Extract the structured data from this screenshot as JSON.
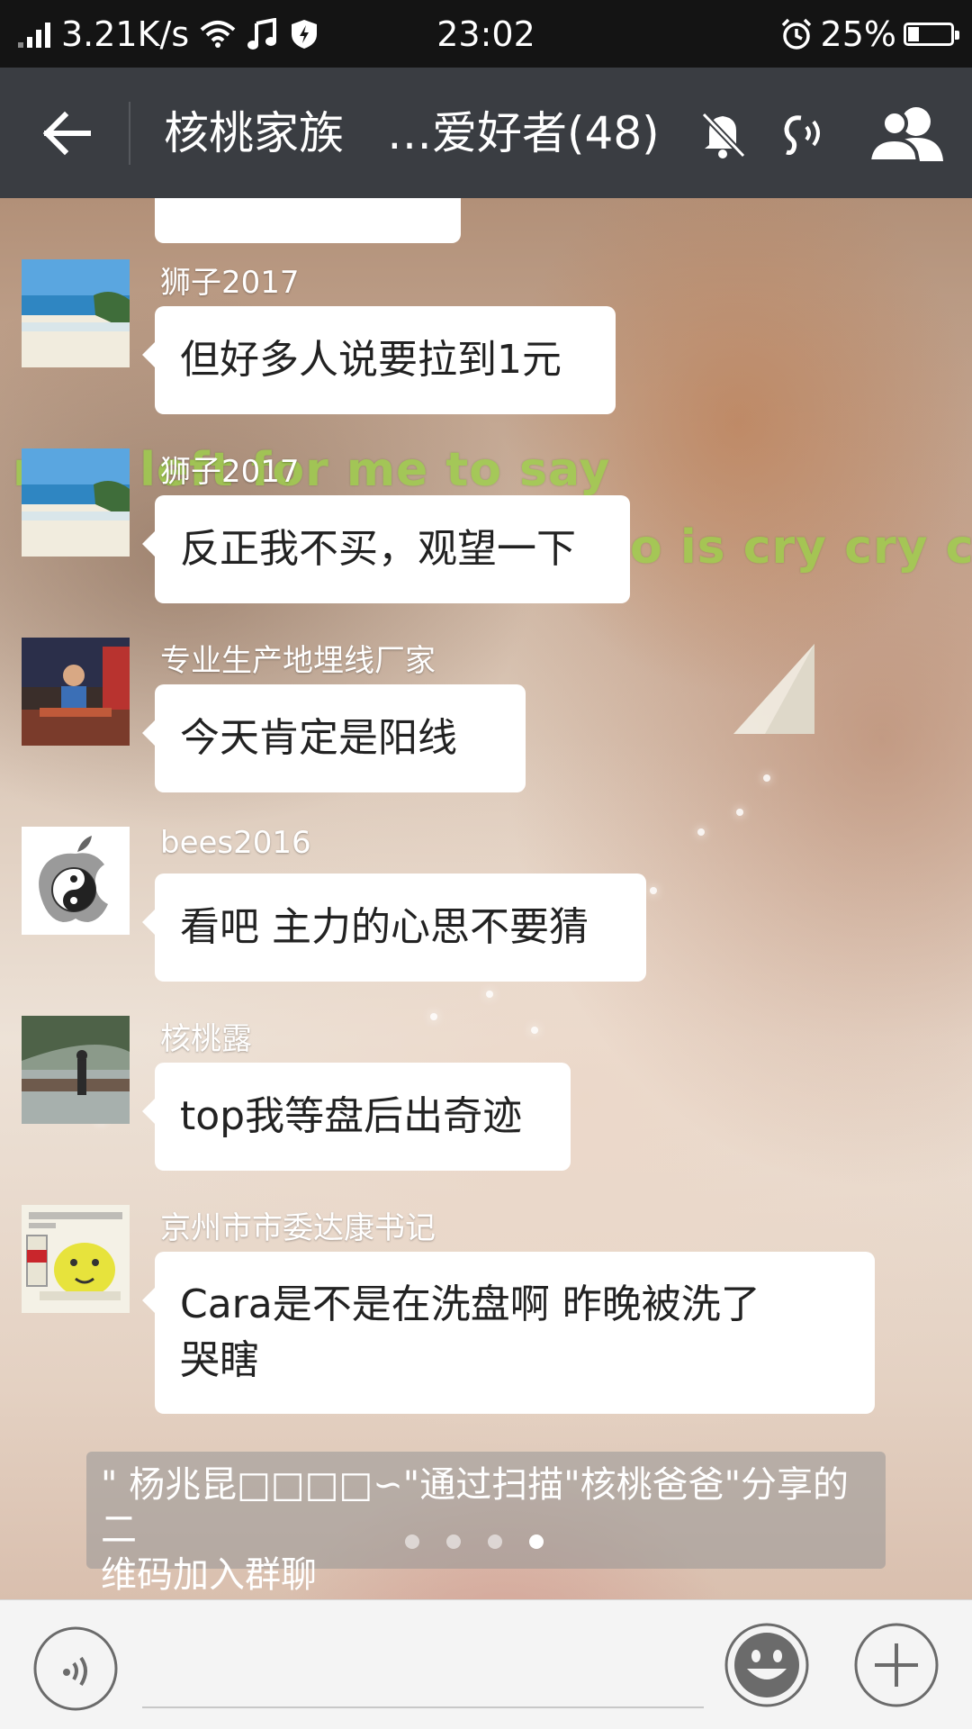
{
  "status_bar": {
    "network_speed": "3.21K/s",
    "time": "23:02",
    "battery": "25%",
    "battery_level": 0.25
  },
  "header": {
    "title_part1": "核桃家族",
    "title_part2": "…爱好者(48)"
  },
  "background_lyrics": {
    "line1": "r ng left for me to say",
    "line2": "o is cry cry cry"
  },
  "messages": [
    {
      "sender": "狮子2017",
      "text": "但好多人说要拉到1元",
      "avatar": "beach-avatar"
    },
    {
      "sender": "狮子2017",
      "text": "反正我不买，观望一下",
      "avatar": "beach-avatar"
    },
    {
      "sender": "专业生产地埋线厂家",
      "text": "今天肯定是阳线",
      "avatar": "man-at-desk-avatar"
    },
    {
      "sender": "bees2016",
      "text": "看吧 主力的心思不要猜",
      "avatar": "yin-yang-apple-avatar"
    },
    {
      "sender": "核桃露",
      "text": "top我等盘后出奇迹",
      "avatar": "riverside-avatar"
    },
    {
      "sender": "京州市市委达康书记",
      "text_line1": "Cara是不是在洗盘啊 昨晚被洗了",
      "text_line2": "哭瞎",
      "avatar": "meme-avatar"
    }
  ],
  "system_notice": {
    "line1": "\" 杨兆昆□□□□∽\"通过扫描\"核桃爸爸\"分享的二",
    "line2": "维码加入群聊"
  },
  "input": {
    "placeholder": ""
  },
  "colors": {
    "status_bar_bg": "#141414",
    "title_bar_bg": "#3a3d42",
    "bubble_bg": "#ffffff",
    "lyric_color": "#9ed04b"
  }
}
